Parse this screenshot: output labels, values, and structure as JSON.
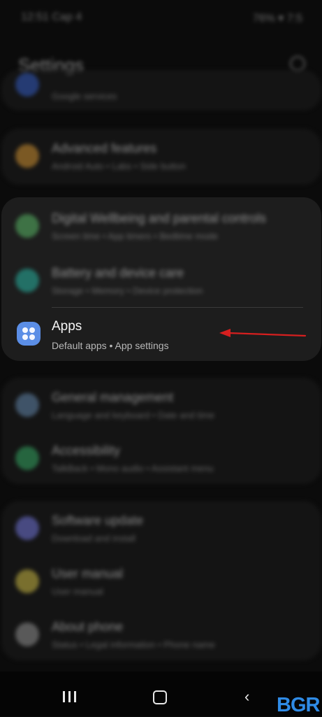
{
  "status": {
    "time": "12:51 Cap 4",
    "right": "76% ▾ 7:5"
  },
  "header": {
    "title": "Settings",
    "search_icon": "search-icon"
  },
  "rows_top": [
    {
      "label": "Google services",
      "sub": "",
      "color": "#3b63c9"
    }
  ],
  "card2": [
    {
      "label": "Advanced features",
      "sub": "Android Auto  •  Labs  •  Side button",
      "color": "#d89a3a"
    }
  ],
  "card3": [
    {
      "label": "Digital Wellbeing and parental controls",
      "sub": "Screen time  •  App timers  •  Bedtime mode",
      "color": "#59b866"
    },
    {
      "label": "Battery and device care",
      "sub": "Storage  •  Memory  •  Device protection",
      "color": "#28b5a3"
    }
  ],
  "apps": {
    "label": "Apps",
    "sub": "Default apps  •  App settings",
    "icon": "apps-icon"
  },
  "card4": [
    {
      "label": "General management",
      "sub": "Language and keyboard  •  Date and time",
      "color": "#6b8fb4"
    },
    {
      "label": "Accessibility",
      "sub": "TalkBack  •  Mono audio  •  Assistant menu",
      "color": "#3db06b"
    }
  ],
  "card5": [
    {
      "label": "Software update",
      "sub": "Download and install",
      "color": "#7a7ee3"
    },
    {
      "label": "User manual",
      "sub": "User manual",
      "color": "#d3c24c"
    },
    {
      "label": "About phone",
      "sub": "Status  •  Legal information  •  Phone name",
      "color": "#9a9a9a"
    }
  ],
  "watermark": "BGR",
  "arrow_color": "#d61f1f"
}
